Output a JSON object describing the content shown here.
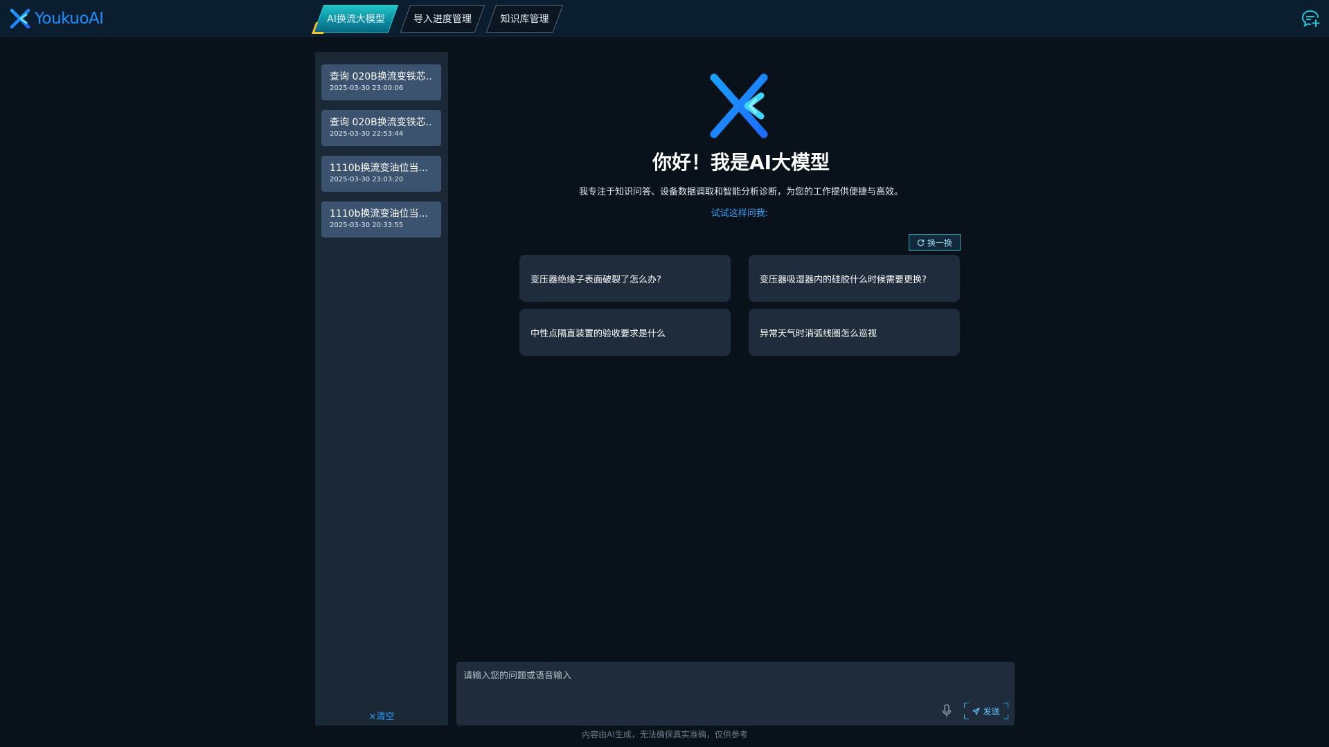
{
  "header": {
    "logo_text": "YoukuoAI",
    "tabs": [
      {
        "label": "AI换流大模型",
        "active": true
      },
      {
        "label": "导入进度管理",
        "active": false
      },
      {
        "label": "知识库管理",
        "active": false
      }
    ],
    "new_chat_icon": "chat-add-icon"
  },
  "sidebar": {
    "history": [
      {
        "title": "查询 020B换流变铁芯...",
        "time": "2025-03-30 23:00:06"
      },
      {
        "title": "查询 020B换流变铁芯...",
        "time": "2025-03-30 22:53:44"
      },
      {
        "title": "1110b换流变油位当...",
        "time": "2025-03-30 23:03:20"
      },
      {
        "title": "1110b换流变油位当...",
        "time": "2025-03-30 20:33:55"
      }
    ],
    "clear_label": "×清空"
  },
  "main": {
    "greeting": "你好！我是AI大模型",
    "subtitle": "我专注于知识问答、设备数据调取和智能分析诊断，为您的工作提供便捷与高效。",
    "try_ask": "试试这样问我:",
    "refresh_label": "换一换",
    "suggestions": [
      "变压器绝缘子表面破裂了怎么办?",
      "变压器吸湿器内的硅胶什么时候需要更换?",
      "中性点隔直装置的验收要求是什么",
      "异常天气时消弧线圈怎么巡视"
    ]
  },
  "input": {
    "placeholder": "请输入您的问题或语音输入",
    "send_label": "发送"
  },
  "footer": {
    "disclaimer": "内容由AI生成，无法确保真实准确，仅供参考"
  },
  "colors": {
    "background": "#09121b",
    "header": "#0b1e2f",
    "sidebar": "#1b2835",
    "history_item": "#3b536e",
    "card": "#1f2c3b",
    "accent_blue": "#2fa4ff",
    "active_tab": "#1fc6c7",
    "tab_corner": "#f5c325"
  }
}
